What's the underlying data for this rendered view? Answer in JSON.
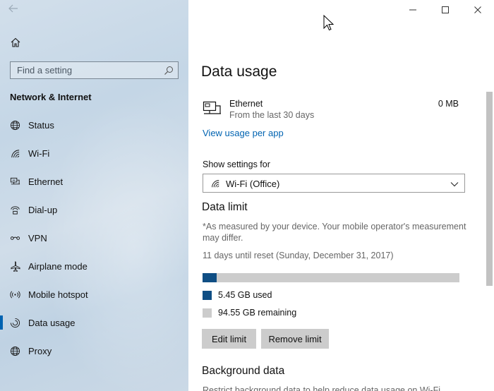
{
  "sidebar": {
    "search_placeholder": "Find a setting",
    "section_title": "Network & Internet",
    "items": [
      {
        "label": "Status",
        "icon": "globe-icon"
      },
      {
        "label": "Wi-Fi",
        "icon": "wifi-icon"
      },
      {
        "label": "Ethernet",
        "icon": "ethernet-icon"
      },
      {
        "label": "Dial-up",
        "icon": "dialup-icon"
      },
      {
        "label": "VPN",
        "icon": "vpn-icon"
      },
      {
        "label": "Airplane mode",
        "icon": "airplane-icon"
      },
      {
        "label": "Mobile hotspot",
        "icon": "hotspot-icon"
      },
      {
        "label": "Data usage",
        "icon": "data-usage-icon",
        "active": true
      },
      {
        "label": "Proxy",
        "icon": "globe-icon"
      }
    ]
  },
  "main": {
    "title": "Data usage",
    "usage": {
      "name": "Ethernet",
      "period": "From the last 30 days",
      "amount": "0 MB"
    },
    "link": "View usage per app",
    "show_settings_label": "Show settings for",
    "network_select": "Wi-Fi (Office)",
    "data_limit_heading": "Data limit",
    "note": "*As measured by your device. Your mobile operator's measurement may differ.",
    "reset_text": "11 days until reset (Sunday, December 31, 2017)",
    "used_fraction": 0.055,
    "used_label": "5.45 GB used",
    "remaining_label": "94.55 GB remaining",
    "edit_button": "Edit limit",
    "remove_button": "Remove limit",
    "background_heading": "Background data",
    "background_text": "Restrict background data to help reduce data usage on Wi-Fi"
  },
  "colors": {
    "accent": "#0063b1",
    "used": "#0f4e84",
    "remaining": "#cccccc"
  }
}
